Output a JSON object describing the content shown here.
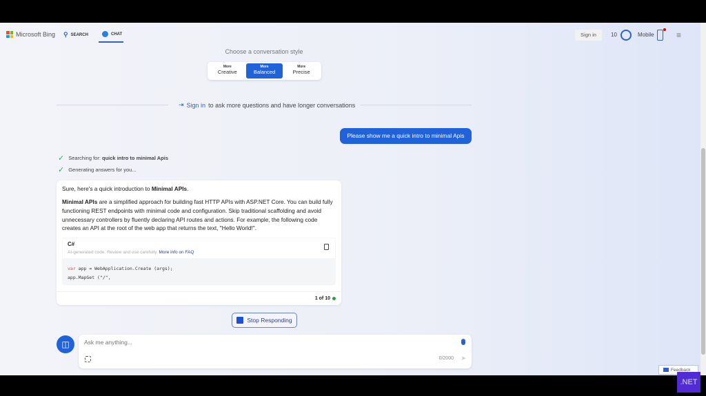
{
  "header": {
    "brand": "Microsoft Bing",
    "nav": [
      {
        "label": "SEARCH"
      },
      {
        "label": "CHAT"
      }
    ],
    "sign_in": "Sign in",
    "rewards_count": "10",
    "mobile": "Mobile"
  },
  "style_picker": {
    "title": "Choose a conversation style",
    "options": [
      {
        "prefix": "More",
        "label": "Creative"
      },
      {
        "prefix": "More",
        "label": "Balanced",
        "selected": true
      },
      {
        "prefix": "More",
        "label": "Precise"
      }
    ]
  },
  "signin_banner": {
    "link": "Sign in",
    "text": "to ask more questions and have longer conversations"
  },
  "user_message": "Please show me a quick intro to minimal Apis",
  "status": [
    {
      "label": "Searching for:",
      "query": "quick intro to minimal Apis"
    },
    {
      "label": "Generating answers for you..."
    }
  ],
  "answer": {
    "intro": "Sure, here's a quick introduction to ",
    "intro_bold": "Minimal APIs",
    "intro_end": ".",
    "para_bold": "Minimal APIs",
    "para": " are a simplified approach for building fast HTTP APIs with ASP.NET Core. You can build fully functioning REST endpoints with minimal code and configuration. Skip traditional scaffolding and avoid unnecessary controllers by fluently declaring API routes and actions. For example, the following code creates an API at the root of the web app that returns the text, \"Hello World!\".",
    "code": {
      "language": "C#",
      "disclaimer": "AI-generated code. Review and use carefully.",
      "faq_link": "More info on FAQ",
      "kw": "var",
      "line1": " app = WebApplication.Create (args);",
      "line2": "app.MapGet (\"/\","
    },
    "pager": "1 of 10"
  },
  "stop_button": "Stop Responding",
  "input": {
    "placeholder": "Ask me anything...",
    "counter": "0/2000"
  },
  "feedback": "Feedback",
  "badge": ".NET"
}
